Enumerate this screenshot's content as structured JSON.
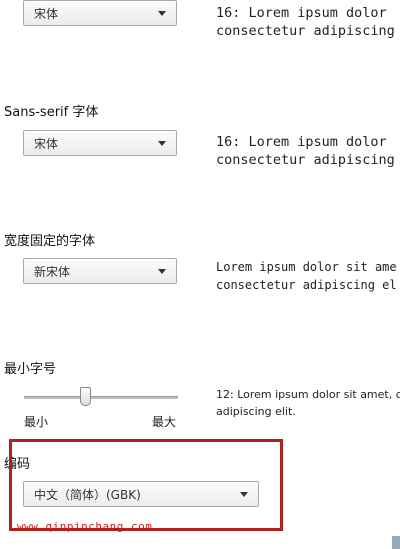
{
  "standard_font": {
    "select_value": "宋体",
    "preview": "16: Lorem ipsum dolor\nconsectetur adipiscing"
  },
  "sans_serif_font": {
    "label": "Sans-serif 字体",
    "select_value": "宋体",
    "preview": "16: Lorem ipsum dolor\nconsectetur adipiscing"
  },
  "fixed_width_font": {
    "label": "宽度固定的字体",
    "select_value": "新宋体",
    "preview": "Lorem ipsum dolor sit ame\nconsectetur adipiscing el"
  },
  "minimum_font_size": {
    "label": "最小字号",
    "min_label": "最小",
    "max_label": "最大",
    "slider_fraction": 0.4,
    "preview": "12: Lorem ipsum dolor sit amet, c\nadipiscing elit."
  },
  "encoding": {
    "label": "编码",
    "select_value": "中文（简体）(GBK)"
  },
  "watermark": "www.qinpinchang.com",
  "colors": {
    "highlight": "#b0201f",
    "watermark": "#d11a1a"
  }
}
